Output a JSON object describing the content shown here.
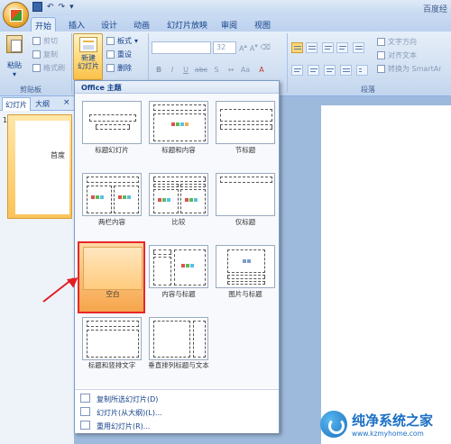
{
  "window": {
    "doc_title": "百度经"
  },
  "tabs": [
    "开始",
    "插入",
    "设计",
    "动画",
    "幻灯片放映",
    "审阅",
    "视图"
  ],
  "ribbon": {
    "paste": "粘贴",
    "cut": "剪切",
    "copy": "复制",
    "format_painter": "格式刷",
    "clipboard": "剪贴板",
    "new_slide": "新建\n幻灯片",
    "layout": "板式",
    "reset": "重设",
    "delete": "删除",
    "font_size": "32",
    "text_direction": "文字方向",
    "align_text": "对齐文本",
    "smartart": "转换为 SmartAr",
    "paragraph": "段落",
    "format_buttons": [
      "B",
      "I",
      "U",
      "abc",
      "S"
    ]
  },
  "panel": {
    "tab_slides": "幻灯片",
    "tab_outline": "大纲",
    "thumb_number": "1",
    "thumb_text": "首度"
  },
  "popup": {
    "header": "Office 主题",
    "layouts": [
      "标题幻灯片",
      "标题和内容",
      "节标题",
      "两栏内容",
      "比较",
      "仅标题",
      "空白",
      "内容与标题",
      "图片与标题",
      "标题和竖排文字",
      "垂直排列标题与文本"
    ],
    "selected_index": 6,
    "menu": [
      "复制所选幻灯片(D)",
      "幻灯片(从大纲)(L)...",
      "重用幻灯片(R)..."
    ]
  },
  "watermark": {
    "title": "纯净系统之家",
    "url": "www.kzmyhome.com"
  }
}
